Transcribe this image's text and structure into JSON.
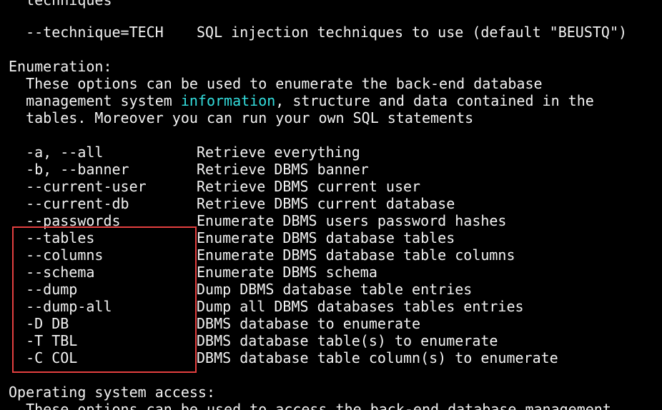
{
  "terminal": {
    "top_partial": "  techniques",
    "technique_option": {
      "opt": "  --technique=TECH",
      "desc": "SQL injection techniques to use (default \"BEUSTQ\")"
    },
    "enum_header": "Enumeration:",
    "enum_desc_1": "  These options can be used to enumerate the back-end database",
    "enum_desc_2_pre": "  management system ",
    "enum_desc_2_hl": "information",
    "enum_desc_2_post": ", structure and data contained in the",
    "enum_desc_3": "  tables. Moreover you can run your own SQL statements",
    "options": [
      {
        "opt": "  -a, --all",
        "desc": "Retrieve everything"
      },
      {
        "opt": "  -b, --banner",
        "desc": "Retrieve DBMS banner"
      },
      {
        "opt": "  --current-user",
        "desc": "Retrieve DBMS current user"
      },
      {
        "opt": "  --current-db",
        "desc": "Retrieve DBMS current database"
      },
      {
        "opt": "  --passwords",
        "desc": "Enumerate DBMS users password hashes"
      },
      {
        "opt": "  --tables",
        "desc": "Enumerate DBMS database tables"
      },
      {
        "opt": "  --columns",
        "desc": "Enumerate DBMS database table columns"
      },
      {
        "opt": "  --schema",
        "desc": "Enumerate DBMS schema"
      },
      {
        "opt": "  --dump",
        "desc": "Dump DBMS database table entries"
      },
      {
        "opt": "  --dump-all",
        "desc": "Dump all DBMS databases tables entries"
      },
      {
        "opt": "  -D DB",
        "desc": "DBMS database to enumerate"
      },
      {
        "opt": "  -T TBL",
        "desc": "DBMS database table(s) to enumerate"
      },
      {
        "opt": "  -C COL",
        "desc": "DBMS database table column(s) to enumerate"
      }
    ],
    "os_header": "Operating system access:",
    "os_desc_1": "  These options can be used to access the back-end database management"
  },
  "colors": {
    "background": "#000000",
    "text": "#f2f2f2",
    "highlight_word": "#33dddd",
    "annotation_box": "#e34040"
  }
}
